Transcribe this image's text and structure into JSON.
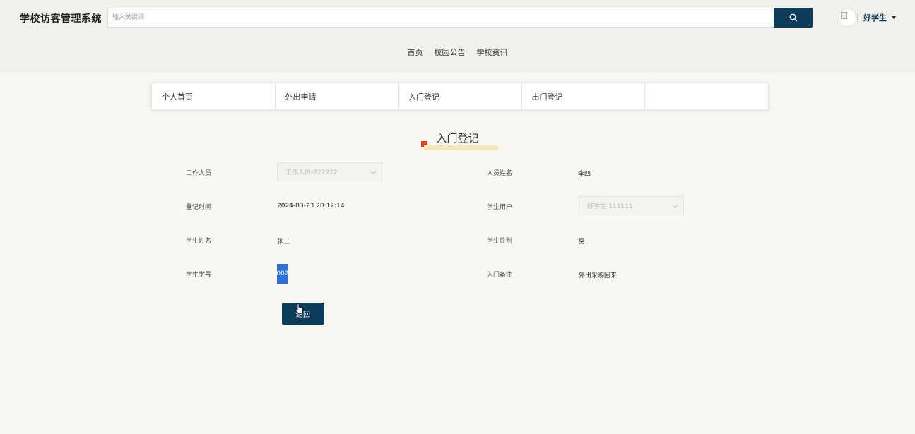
{
  "header": {
    "brand": "学校访客管理系统",
    "search_placeholder": "输入关键词",
    "user_name": "好学生"
  },
  "nav": {
    "items": [
      "首页",
      "校园公告",
      "学校资讯"
    ]
  },
  "sub_nav": {
    "items": [
      "个人首页",
      "外出申请",
      "入门登记",
      "出门登记"
    ]
  },
  "form": {
    "title": "入门登记",
    "worker_label": "工作人员",
    "worker_value": "工作人员-222222",
    "person_name_label": "人员姓名",
    "person_name_value": "李四",
    "register_time_label": "登记时间",
    "register_time_value": "2024-03-23 20:12:14",
    "student_user_label": "学生用户",
    "student_user_value": "好学生-111111",
    "student_name_label": "学生姓名",
    "student_name_value": "张三",
    "student_gender_label": "学生性别",
    "student_gender_value": "男",
    "student_no_label": "学生学号",
    "student_no_value": "002",
    "remark_label": "入门备注",
    "remark_value": "外出采购回来",
    "back_button": "返回"
  },
  "colors": {
    "primary": "#0d3c5a",
    "accent_red": "#e2421b",
    "accent_yellow": "#f5e7b6",
    "background": "#f8f7f1",
    "header_bg": "#f2f0eb",
    "selection": "#2f6fd8"
  }
}
